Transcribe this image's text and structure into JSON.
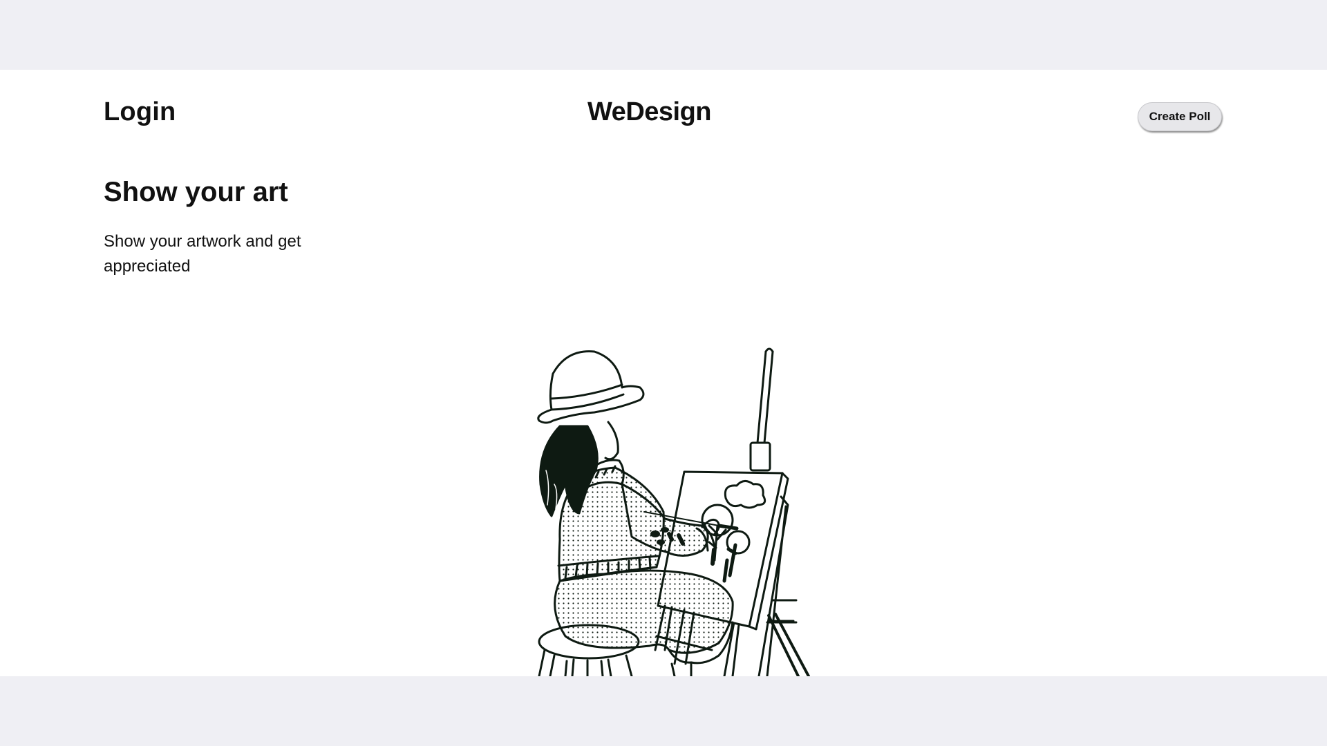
{
  "header": {
    "login_label": "Login",
    "brand": "WeDesign",
    "create_poll_label": "Create Poll"
  },
  "hero": {
    "title": "Show your art",
    "description": "Show your artwork and get appreciated"
  },
  "illustration": {
    "subject": "girl-painting-at-easel-icon",
    "ink_color": "#0e1a12"
  },
  "colors": {
    "backdrop": "#efeff4",
    "page": "#ffffff",
    "text": "#111111",
    "button_bg": "#e7e7ea"
  }
}
